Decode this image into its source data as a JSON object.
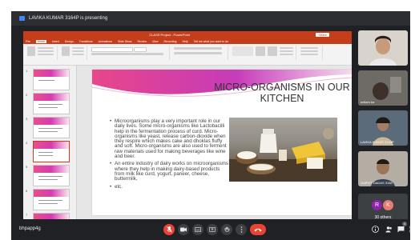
{
  "banner": {
    "text": "LAVIKA KUMAR 3164P is presenting"
  },
  "ppt": {
    "title_bar": "CLASS Project - PowerPoint",
    "share_label": "Share",
    "tabs": [
      "File",
      "Home",
      "Insert",
      "Design",
      "Transitions",
      "Animations",
      "Slide Show",
      "Review",
      "View",
      "Recording",
      "Help",
      "Tell me what you want to do"
    ],
    "active_tab": "Home",
    "status_left": "Slide 5 of 7",
    "status_right": "Notes"
  },
  "slide": {
    "title": "MICRO-ORGANISMS IN OUR KITCHEN",
    "bullets": [
      "Microorganisms play a very important role in our daily lives. Some micro-organisms like Lactobacilli help in the fermentation process of curd. Micro-organisms like yeast, release carbon-dioxide when they respire which makes cake and dhoklas fluffy and soft. Micro-organisms are also used to ferment raw materials used for making beverages like wine and beer.",
      "An entire industry of dairy works on microorganisms where they help in making dairy-based products from milk like curd, yogurt, paneer, cheese, buttermilk,",
      "etc."
    ]
  },
  "participants": [
    {
      "name": ""
    },
    {
      "name": "neilam ka"
    },
    {
      "name": "LAVIKA KUMAR 3164P"
    },
    {
      "name": "GARVIT DADAS 3168"
    }
  ],
  "others": {
    "initials": [
      "R",
      "K"
    ],
    "label": "30 others"
  },
  "callbar": {
    "meeting_code": "bhpapp4g",
    "people_count": "4"
  },
  "colors": {
    "ppt_accent": "#c43e1c",
    "end_call": "#ea4335",
    "meet_bg": "#202124"
  }
}
